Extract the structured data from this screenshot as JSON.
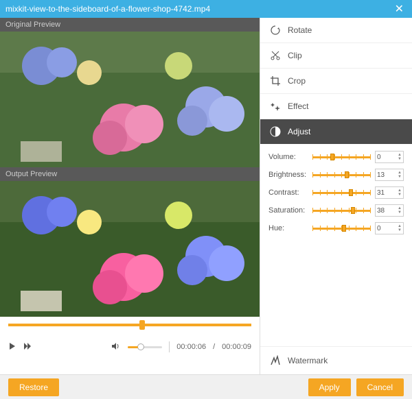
{
  "titlebar": {
    "filename": "mixkit-view-to-the-sideboard-of-a-flower-shop-4742.mp4"
  },
  "previews": {
    "original_label": "Original Preview",
    "output_label": "Output Preview"
  },
  "playback": {
    "current": "00:00:06",
    "duration": "00:00:09"
  },
  "tools": {
    "rotate": "Rotate",
    "clip": "Clip",
    "crop": "Crop",
    "effect": "Effect",
    "adjust": "Adjust",
    "watermark": "Watermark"
  },
  "adjust": {
    "volume": {
      "label": "Volume:",
      "value": "0",
      "pos": 30
    },
    "brightness": {
      "label": "Brightness:",
      "value": "13",
      "pos": 55
    },
    "contrast": {
      "label": "Contrast:",
      "value": "31",
      "pos": 62
    },
    "saturation": {
      "label": "Saturation:",
      "value": "38",
      "pos": 66
    },
    "hue": {
      "label": "Hue:",
      "value": "0",
      "pos": 50
    }
  },
  "footer": {
    "restore": "Restore",
    "apply": "Apply",
    "cancel": "Cancel"
  }
}
